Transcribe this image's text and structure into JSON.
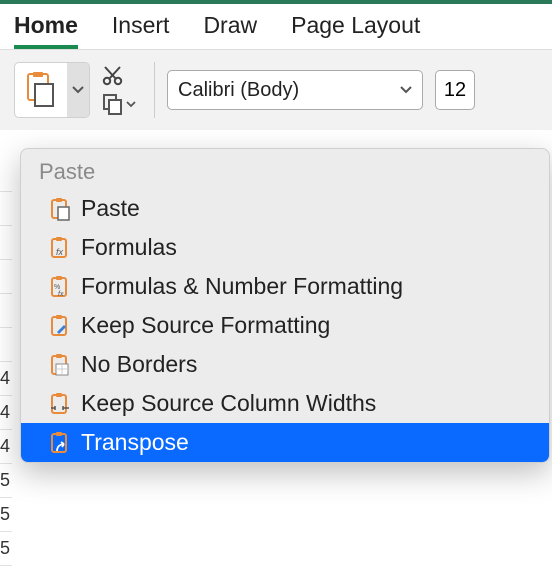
{
  "tabs": {
    "home": "Home",
    "insert": "Insert",
    "draw": "Draw",
    "page_layout": "Page Layout"
  },
  "ribbon": {
    "font_name": "Calibri (Body)",
    "font_size": "12"
  },
  "paste_menu": {
    "header": "Paste",
    "items": {
      "paste": "Paste",
      "formulas": "Formulas",
      "formulas_number": "Formulas & Number Formatting",
      "keep_source": "Keep Source Formatting",
      "no_borders": "No Borders",
      "keep_widths": "Keep Source Column Widths",
      "transpose": "Transpose"
    }
  },
  "row_headers": [
    "",
    "",
    "",
    "",
    "",
    "",
    "4",
    "4",
    "4",
    "5",
    "5",
    "5"
  ],
  "peek_text": ","
}
